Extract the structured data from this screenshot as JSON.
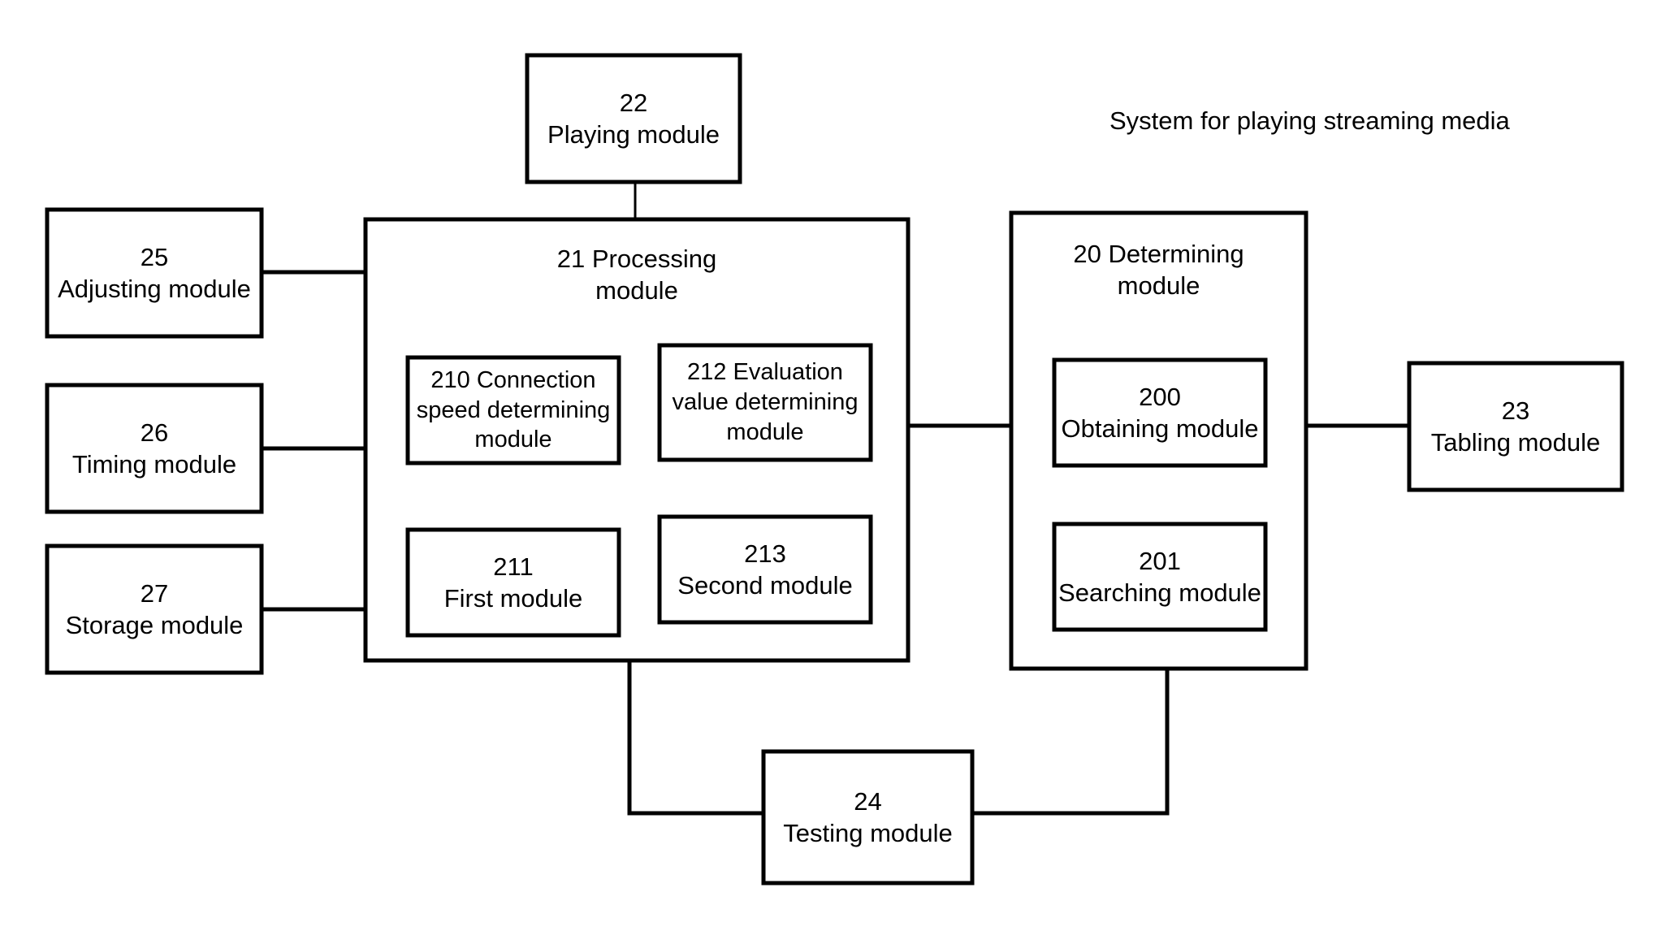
{
  "diagram": {
    "title": "System for playing streaming media",
    "type": "block-diagram",
    "background_color": "#ffffff",
    "line_color": "#000000",
    "boxes": {
      "playing": {
        "number": "22",
        "name": "Playing module"
      },
      "processing": {
        "number": "21",
        "name": "Processing module",
        "label": "21 Processing\nmodule"
      },
      "adjusting": {
        "number": "25",
        "name": "Adjusting module"
      },
      "timing": {
        "number": "26",
        "name": "Timing module"
      },
      "storage": {
        "number": "27",
        "name": "Storage module"
      },
      "connection_speed": {
        "number": "210",
        "name": "Connection speed determining module",
        "label": "210 Connection\nspeed determining\nmodule"
      },
      "first": {
        "number": "211",
        "name": "First module"
      },
      "evaluation_value": {
        "number": "212",
        "name": "Evaluation value determining module",
        "label": "212 Evaluation\nvalue determining\nmodule"
      },
      "second": {
        "number": "213",
        "name": "Second module"
      },
      "determining": {
        "number": "20",
        "name": "Determining module",
        "label": "20 Determining\nmodule"
      },
      "obtaining": {
        "number": "200",
        "name": "Obtaining module"
      },
      "searching": {
        "number": "201",
        "name": "Searching module"
      },
      "tabling": {
        "number": "23",
        "name": "Tabling module"
      },
      "testing": {
        "number": "24",
        "name": "Testing module"
      }
    },
    "connections": [
      {
        "from": "playing",
        "to": "processing"
      },
      {
        "from": "adjusting",
        "to": "processing"
      },
      {
        "from": "timing",
        "to": "processing"
      },
      {
        "from": "storage",
        "to": "processing"
      },
      {
        "from": "connection_speed",
        "to": "first"
      },
      {
        "from": "evaluation_value",
        "to": "second"
      },
      {
        "from": "processing",
        "to": "determining"
      },
      {
        "from": "obtaining",
        "to": "searching"
      },
      {
        "from": "determining",
        "to": "tabling"
      },
      {
        "from": "processing",
        "to": "testing"
      },
      {
        "from": "testing",
        "to": "determining"
      }
    ]
  }
}
